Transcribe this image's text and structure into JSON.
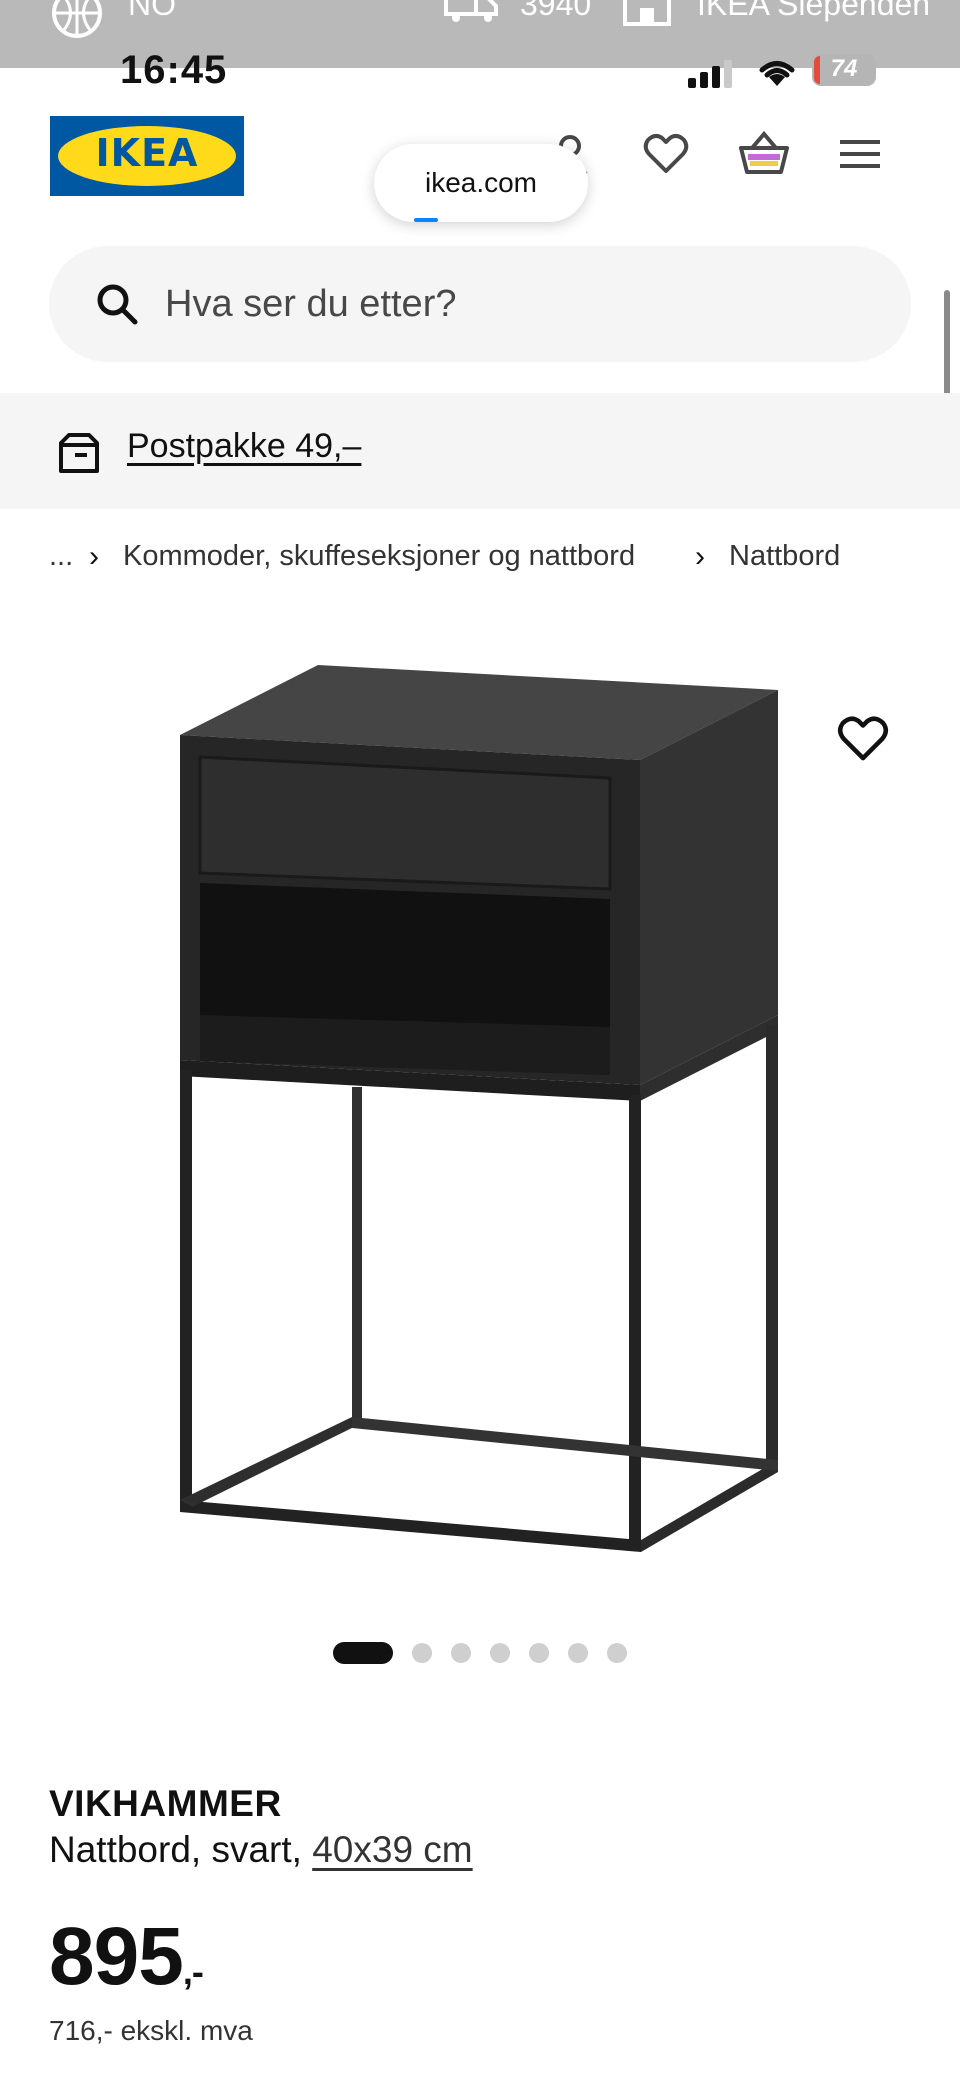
{
  "top_bar": {
    "language": "NO",
    "zip": "3940",
    "store": "IKEA Slependen"
  },
  "status_bar": {
    "time": "16:45",
    "battery": "74"
  },
  "header": {
    "logo_text": "IKEA",
    "url": "ikea.com",
    "icons": [
      "user-icon",
      "heart-icon",
      "basket-icon",
      "menu-icon"
    ]
  },
  "search": {
    "placeholder": "Hva ser du etter?"
  },
  "banner": {
    "text": "Postpakke 49,–"
  },
  "breadcrumb": {
    "ellipsis": "...",
    "items": [
      "Kommoder, skuffeseksjoner og nattbord",
      "Nattbord"
    ]
  },
  "gallery": {
    "image_count": 7,
    "active_index": 0
  },
  "product": {
    "name": "VIKHAMMER",
    "description": "Nattbord, svart,",
    "size": "40x39 cm",
    "price_main": "895",
    "price_suffix": ",-",
    "price_ex_vat": "716,- ekskl. mva"
  },
  "colors": {
    "ikea_blue": "#0058a3",
    "ikea_yellow": "#ffda1a",
    "product_black": "#2b2b2b"
  }
}
